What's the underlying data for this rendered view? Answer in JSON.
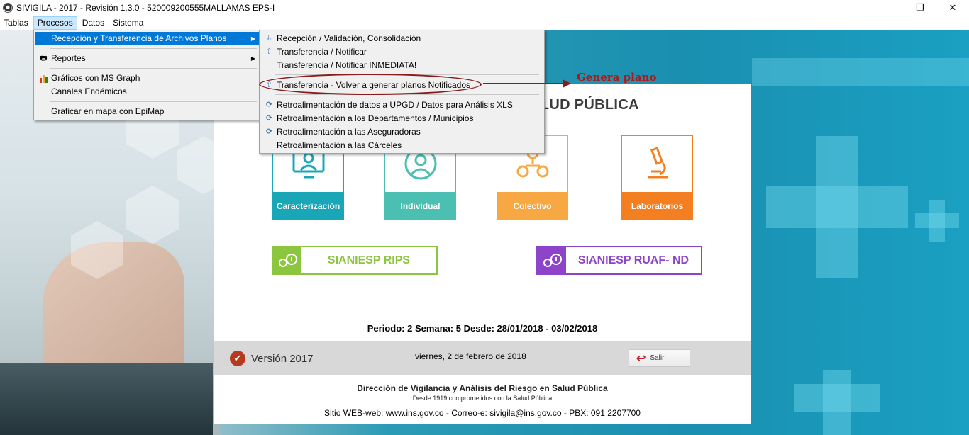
{
  "window": {
    "title": "SIVIGILA - 2017 - Revisión 1.3.0 - 520009200555MALLAMAS EPS-I",
    "controls": {
      "minimize": "—",
      "restore": "❐",
      "close": "✕"
    }
  },
  "menubar": {
    "items": [
      {
        "label": "Tablas"
      },
      {
        "label": "Procesos"
      },
      {
        "label": "Datos"
      },
      {
        "label": "Sistema"
      }
    ]
  },
  "procesos_menu": {
    "items": [
      {
        "label": "Recepción y Transferencia de Archivos Planos",
        "highlighted": true,
        "submenu": true
      },
      {
        "label": "Reportes",
        "submenu": true,
        "icon": "printer-icon"
      },
      {
        "label": "Gráficos con MS Graph",
        "icon": "bar-chart-icon"
      },
      {
        "label": "Canales Endémicos"
      },
      {
        "label": "Graficar en mapa con EpiMap"
      }
    ]
  },
  "submenu": {
    "items": [
      {
        "label": "Recepción / Validación, Consolidación",
        "icon": "arrow-down-icon"
      },
      {
        "label": "Transferencia / Notificar",
        "icon": "arrow-up-icon"
      },
      {
        "label": "Transferencia / Notificar INMEDIATA!"
      },
      {
        "label": "Transferencia - Volver a generar planos Notificados",
        "icon": "arrow-up-icon"
      },
      {
        "label": "Retroalimentación de datos a UPGD / Datos para Análisis XLS",
        "icon": "refresh-icon"
      },
      {
        "label": "Retroalimentación a los Departamentos / Municipios",
        "icon": "refresh-icon"
      },
      {
        "label": "Retroalimentación a las Aseguradoras",
        "icon": "refresh-icon"
      },
      {
        "label": "Retroalimentación a las Cárceles"
      }
    ]
  },
  "annotation": {
    "text": "Genera plano",
    "color": "#8b1a1a"
  },
  "main": {
    "heading": "EN SALUD PÚBLICA",
    "tiles": [
      {
        "label": "Caracterización",
        "color": "#19a7b7",
        "icon": "monitor-user-icon"
      },
      {
        "label": "Individual",
        "color": "#4bbfb1",
        "icon": "person-icon"
      },
      {
        "label": "Colectivo",
        "color": "#f7a842",
        "icon": "group-icon"
      },
      {
        "label": "Laboratorios",
        "color": "#f47f20",
        "icon": "microscope-icon"
      }
    ],
    "sianiesp": [
      {
        "label": "SIANIESP RIPS",
        "color": "#8cc63f"
      },
      {
        "label": "SIANIESP RUAF- ND",
        "color": "#8e44c8"
      }
    ],
    "periodo": "Periodo: 2 Semana: 5 Desde: 28/01/2018 - 03/02/2018",
    "version": "Versión 2017",
    "fecha": "viernes, 2 de febrero de 2018",
    "salir": "Salir",
    "direccion": "Dirección de Vigilancia y Análisis del Riesgo en Salud Pública",
    "desde": "Desde 1919  comprometidos con la Salud Pública",
    "sitio": "Sitio WEB-web: www.ins.gov.co - Correo-e: sivigila@ins.gov.co - PBX: 091 2207700"
  }
}
